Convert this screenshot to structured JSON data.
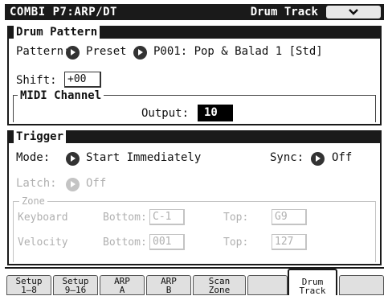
{
  "header": {
    "title": "COMBI P7:ARP/DT",
    "page": "Drum Track",
    "menu_icon": "chevron-down-icon"
  },
  "drum_pattern": {
    "heading": "Drum Pattern",
    "pattern_label": "Pattern:",
    "bank": "Preset",
    "pattern": "P001: Pop & Balad 1 [Std]",
    "shift_label": "Shift:",
    "shift_value": "+00",
    "midi_heading": "MIDI Channel",
    "output_label": "Output:",
    "output_value": "10"
  },
  "trigger": {
    "heading": "Trigger",
    "mode_label": "Mode:",
    "mode_value": "Start Immediately",
    "sync_label": "Sync:",
    "sync_value": "Off",
    "latch_label": "Latch:",
    "latch_value": "Off",
    "zone_heading": "Zone",
    "keyboard_label": "Keyboard",
    "velocity_label": "Velocity",
    "bottom_label": "Bottom:",
    "top_label": "Top:",
    "kbd_bottom": "C-1",
    "kbd_top": "G9",
    "vel_bottom": "001",
    "vel_top": "127"
  },
  "tabs": [
    {
      "l1": "Setup",
      "l2": "1–8"
    },
    {
      "l1": "Setup",
      "l2": "9–16"
    },
    {
      "l1": "ARP",
      "l2": "A"
    },
    {
      "l1": "ARP",
      "l2": "B"
    },
    {
      "l1": "Scan",
      "l2": "Zone"
    },
    {
      "l1": "Drum",
      "l2": "Track"
    }
  ]
}
